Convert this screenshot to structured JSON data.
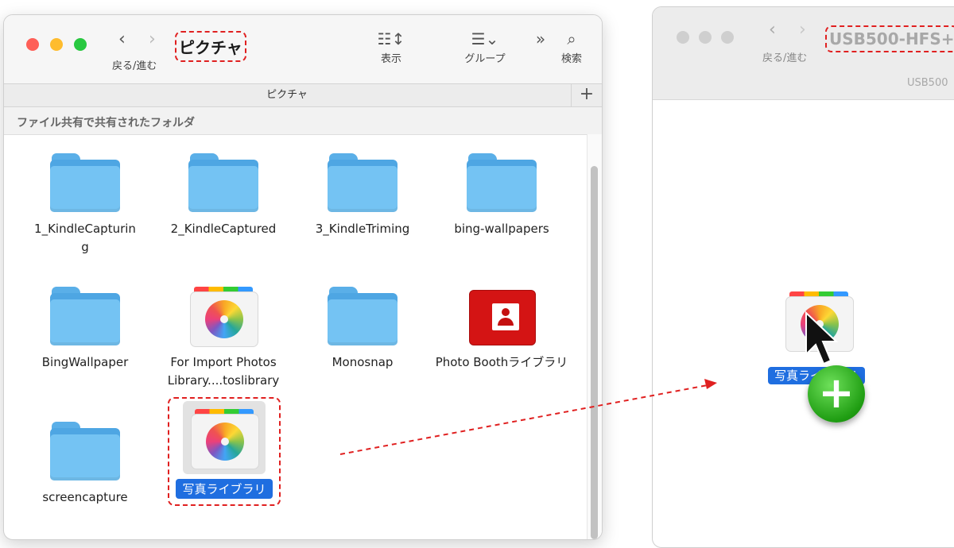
{
  "window_left": {
    "title": "ピクチャ",
    "back_forward_label": "戻る/進む",
    "view_label": "表示",
    "group_label": "グループ",
    "search_label": "検索",
    "tab_title": "ピクチャ",
    "tab_add": "+",
    "section_header": "ファイル共有で共有されたフォルダ",
    "items": [
      {
        "name": "1_KindleCapturin\ng",
        "type": "folder"
      },
      {
        "name": "2_KindleCaptured",
        "type": "folder"
      },
      {
        "name": "3_KindleTriming",
        "type": "folder"
      },
      {
        "name": "bing-wallpapers",
        "type": "folder"
      },
      {
        "name": "BingWallpaper",
        "type": "folder"
      },
      {
        "name": "For Import Photos Library....toslibrary",
        "type": "photos-library"
      },
      {
        "name": "Monosnap",
        "type": "folder"
      },
      {
        "name": "Photo Boothライブラリ",
        "type": "photo-booth-library"
      },
      {
        "name": "screencapture",
        "type": "folder"
      },
      {
        "name": "写真ライブラリ",
        "type": "photos-library",
        "selected": true
      }
    ]
  },
  "window_right": {
    "title": "USB500-HFS+",
    "back_forward_label": "戻る/進む",
    "tab_title": "USB500"
  },
  "drag": {
    "label": "写真ライブラリ",
    "badge": "+"
  },
  "colors": {
    "selection": "#1f6ee0",
    "annotation": "#e02020",
    "folder": "#74c3f3"
  }
}
